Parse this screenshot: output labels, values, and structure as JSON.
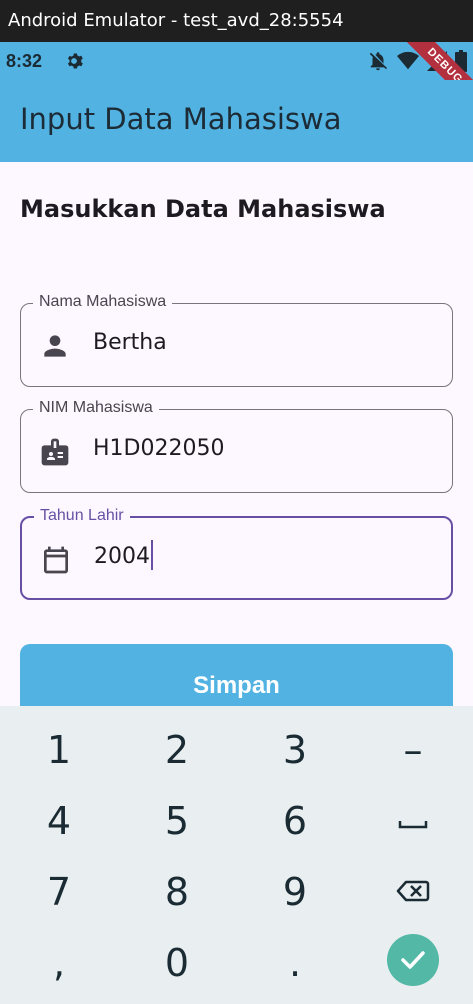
{
  "window": {
    "title": "Android Emulator - test_avd_28:5554"
  },
  "status_bar": {
    "time": "8:32",
    "debug_label": "DEBUG"
  },
  "app_bar": {
    "title": "Input Data Mahasiswa"
  },
  "form": {
    "heading": "Masukkan Data Mahasiswa",
    "fields": [
      {
        "label": "Nama Mahasiswa",
        "value": "Bertha",
        "icon": "person-icon"
      },
      {
        "label": "NIM Mahasiswa",
        "value": "H1D022050",
        "icon": "badge-icon"
      },
      {
        "label": "Tahun Lahir",
        "value": "2004",
        "icon": "calendar-icon"
      }
    ],
    "submit_label": "Simpan"
  },
  "keyboard": {
    "rows": [
      [
        "1",
        "2",
        "3",
        "–"
      ],
      [
        "4",
        "5",
        "6",
        "␣"
      ],
      [
        "7",
        "8",
        "9",
        "⌫"
      ],
      [
        ",",
        "0",
        ".",
        "✓"
      ]
    ]
  },
  "colors": {
    "primary": "#52b3e3",
    "focus": "#6750a4",
    "background": "#fdf7ff",
    "keyboard": "#e9eef1",
    "done_key": "#53b8a5",
    "debug_ribbon": "#b3313f"
  }
}
